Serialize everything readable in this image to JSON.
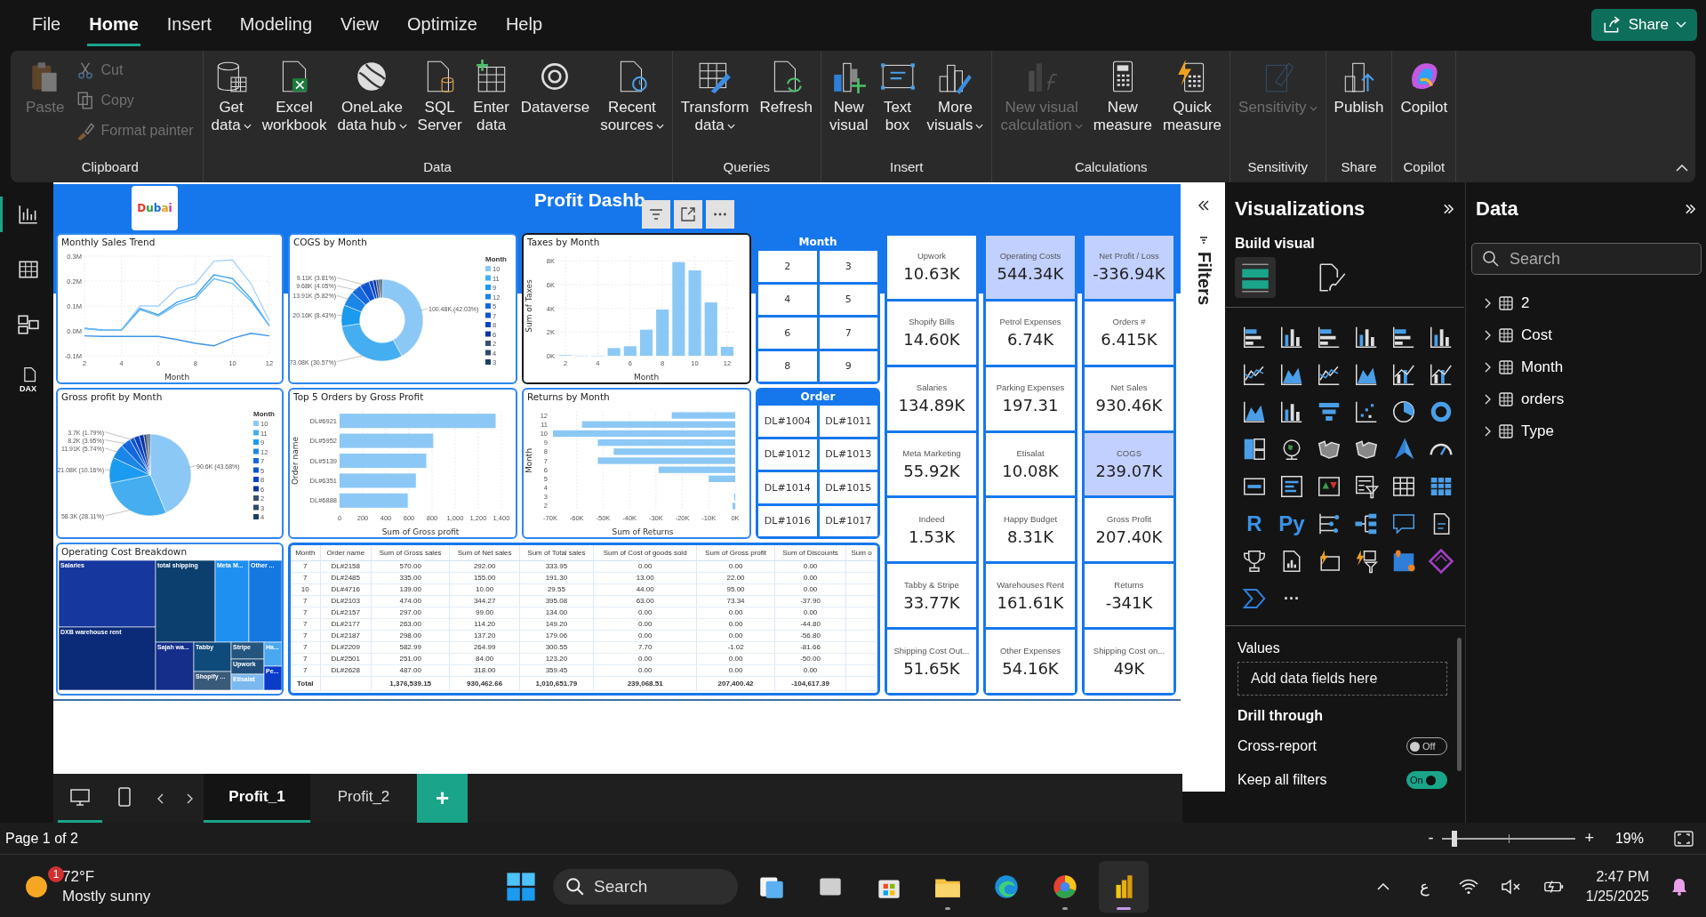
{
  "menu": [
    {
      "label": "File",
      "selected": false
    },
    {
      "label": "Home",
      "selected": true
    },
    {
      "label": "Insert",
      "selected": false
    },
    {
      "label": "Modeling",
      "selected": false
    },
    {
      "label": "View",
      "selected": false
    },
    {
      "label": "Optimize",
      "selected": false
    },
    {
      "label": "Help",
      "selected": false
    }
  ],
  "share": {
    "label": "Share"
  },
  "ribbon": {
    "groups": [
      {
        "label": "Clipboard",
        "buttons": [
          {
            "label": "Paste",
            "kind": "large",
            "disabled": true
          },
          {
            "label": "Cut",
            "kind": "small",
            "disabled": true
          },
          {
            "label": "Copy",
            "kind": "small",
            "disabled": true
          },
          {
            "label": "Format painter",
            "kind": "small",
            "disabled": true
          }
        ]
      },
      {
        "label": "Data",
        "buttons": [
          {
            "label": "Get\ndata",
            "kind": "large",
            "disabled": false,
            "dropdown": true
          },
          {
            "label": "Excel\nworkbook",
            "kind": "large",
            "disabled": false
          },
          {
            "label": "OneLake\ndata hub",
            "kind": "large",
            "disabled": false,
            "dropdown": true
          },
          {
            "label": "SQL\nServer",
            "kind": "large",
            "disabled": false
          },
          {
            "label": "Enter\ndata",
            "kind": "large",
            "disabled": false
          },
          {
            "label": "Dataverse",
            "kind": "large",
            "disabled": false
          },
          {
            "label": "Recent\nsources",
            "kind": "large",
            "disabled": false,
            "dropdown": true
          }
        ]
      },
      {
        "label": "Queries",
        "buttons": [
          {
            "label": "Transform\ndata",
            "kind": "large",
            "disabled": false,
            "dropdown": true
          },
          {
            "label": "Refresh",
            "kind": "large",
            "disabled": false
          }
        ]
      },
      {
        "label": "Insert",
        "buttons": [
          {
            "label": "New\nvisual",
            "kind": "large",
            "disabled": false
          },
          {
            "label": "Text\nbox",
            "kind": "large",
            "disabled": false
          },
          {
            "label": "More\nvisuals",
            "kind": "large",
            "disabled": false,
            "dropdown": true
          }
        ]
      },
      {
        "label": "Calculations",
        "buttons": [
          {
            "label": "New visual\ncalculation",
            "kind": "large",
            "disabled": true,
            "dropdown": true
          },
          {
            "label": "New\nmeasure",
            "kind": "large",
            "disabled": false
          },
          {
            "label": "Quick\nmeasure",
            "kind": "large",
            "disabled": false
          }
        ]
      },
      {
        "label": "Sensitivity",
        "buttons": [
          {
            "label": "Sensitivity",
            "kind": "large",
            "disabled": true,
            "dropdown": true
          }
        ]
      },
      {
        "label": "Share",
        "buttons": [
          {
            "label": "Publish",
            "kind": "large",
            "disabled": false
          }
        ]
      },
      {
        "label": "Copilot",
        "buttons": [
          {
            "label": "Copilot",
            "kind": "large",
            "disabled": false
          }
        ]
      }
    ]
  },
  "left_nav": [
    {
      "selected": true
    },
    {
      "selected": false
    },
    {
      "selected": false
    },
    {
      "selected": false,
      "label": "DAX"
    }
  ],
  "dashboard": {
    "logo": "Dubai",
    "title": "Profit Dashb",
    "charts": [
      {
        "title": "Monthly Sales Trend",
        "selected": false,
        "chart_data": {
          "type": "line",
          "grid": true,
          "xlabel": "Month",
          "x": [
            2,
            3,
            4,
            5,
            6,
            7,
            8,
            9,
            10,
            11,
            12
          ],
          "xlim": [
            2,
            12
          ],
          "ylim": [
            -0.1,
            0.3
          ],
          "xticks": [
            2,
            4,
            6,
            8,
            10,
            12
          ],
          "yticks": [
            {
              "value": -0.1,
              "label": "-0.1M"
            },
            {
              "value": 0,
              "label": "0.0M"
            },
            {
              "value": 0.1,
              "label": "0.1M"
            },
            {
              "value": 0.2,
              "label": "0.2M"
            },
            {
              "value": 0.3,
              "label": "0.3M"
            }
          ],
          "series": [
            {
              "color": "#a9d2f7",
              "values": [
                0.01,
                0.005,
                0.005,
                0.1,
                0.1,
                0.17,
                0.19,
                0.28,
                0.285,
                0.19,
                0.04
              ]
            },
            {
              "color": "#3da3f0",
              "values": [
                0.01,
                0.003,
                0.002,
                0.09,
                0.065,
                0.115,
                0.14,
                0.225,
                0.21,
                0.13,
                0.02
              ]
            },
            {
              "color": "#6cbaf2",
              "values": [
                0.01,
                0.003,
                0.002,
                0.085,
                0.06,
                0.105,
                0.13,
                0.21,
                0.19,
                0.12,
                0.02
              ]
            },
            {
              "color": "#3a94ea",
              "values": [
                -0.02,
                -0.022,
                -0.022,
                -0.022,
                -0.022,
                -0.035,
                -0.05,
                -0.06,
                -0.03,
                -0.01,
                -0.02
              ]
            }
          ]
        }
      },
      {
        "title": "COGS by Month",
        "selected": false,
        "chart_data": {
          "type": "donut",
          "legend": {
            "title": "Month"
          },
          "categories": [
            "10",
            "11",
            "9",
            "12",
            "5",
            "7",
            "8",
            "6",
            "2",
            "4",
            "3"
          ],
          "values": [
            100480,
            73080,
            20160,
            13910,
            9680,
            9110,
            3800,
            3000,
            2300,
            1900,
            1650
          ],
          "colors": [
            "#8cc8f5",
            "#45aef0",
            "#1a9bef",
            "#1a86e6",
            "#1468dc",
            "#0d55d0",
            "#0a44c0",
            "#0a36a0",
            "#3a4e6e",
            "#2c4a6a",
            "#1e3e66"
          ],
          "value_labels": [
            "100.48K (42.03%)",
            "73.08K (30.57%)",
            "20.16K (8.43%)",
            "13.91K (5.82%)",
            "9.68K (4.05%)",
            "9.11K (3.81%)",
            null,
            null,
            null,
            null,
            null
          ]
        }
      },
      {
        "title": "Taxes by Month",
        "selected": true,
        "chart_data": {
          "type": "bar",
          "grid": true,
          "xlabel": "Month",
          "ylabel": "Sum of Taxes",
          "x": [
            2,
            3,
            4,
            5,
            6,
            7,
            8,
            9,
            10,
            11,
            12
          ],
          "xlim": [
            1.5,
            12.5
          ],
          "ylim": [
            0,
            8.4
          ],
          "xticks": [
            2,
            4,
            6,
            8,
            10,
            12
          ],
          "yticks": [
            {
              "value": 0,
              "label": "0K"
            },
            {
              "value": 2,
              "label": "2K"
            },
            {
              "value": 4,
              "label": "4K"
            },
            {
              "value": 6,
              "label": "6K"
            },
            {
              "value": 8,
              "label": "8K"
            }
          ],
          "series": [
            {
              "color": "#8cc8f5",
              "values": [
                0.05,
                0,
                0,
                0.65,
                0.8,
                2.2,
                3.9,
                7.9,
                7.2,
                4.5,
                0.75
              ]
            }
          ]
        }
      },
      {
        "title": "Gross profit by Month",
        "selected": false,
        "chart_data": {
          "type": "pie",
          "legend": {
            "title": "Month"
          },
          "categories": [
            "10",
            "11",
            "9",
            "12",
            "7",
            "5",
            "8",
            "6",
            "2",
            "3",
            "4"
          ],
          "values": [
            90600,
            58300,
            21080,
            11910,
            8200,
            3700,
            4500,
            3800,
            2500,
            1600,
            1200
          ],
          "colors": [
            "#8cc8f5",
            "#45aef0",
            "#1a9bef",
            "#1a86e6",
            "#1468dc",
            "#0d55d0",
            "#0a44c0",
            "#0a36a0",
            "#3a4e6e",
            "#2c4a6a",
            "#1e3e66"
          ],
          "value_labels": [
            "90.6K (43.68%)",
            "58.3K (28.11%)",
            "21.08K (10.16%)",
            "11.91K (5.74%)",
            "8.2K (3.95%)",
            "3.7K (1.79%)",
            null,
            null,
            null,
            null,
            null
          ]
        }
      },
      {
        "title": "Top 5 Orders by Gross Profit",
        "selected": false,
        "chart_data": {
          "type": "bar",
          "orientation": "horizontal",
          "grid": true,
          "xlabel": "Sum of Gross profit",
          "ylabel": "Order name",
          "categories": [
            "DL#6921",
            "DL#5952",
            "DL#5139",
            "DL#6351",
            "DL#6888"
          ],
          "xlim": [
            0,
            1400
          ],
          "xticks": [
            0,
            200,
            400,
            600,
            800,
            {
              "value": 1000,
              "label": "1,000"
            },
            {
              "value": 1200,
              "label": "1,200"
            },
            {
              "value": 1400,
              "label": "1,400"
            }
          ],
          "series": [
            {
              "color": "#8cc8f5",
              "values": [
                1350,
                810,
                750,
                660,
                590
              ]
            }
          ]
        }
      },
      {
        "title": "Returns by Month",
        "selected": false,
        "chart_data": {
          "type": "bar",
          "orientation": "horizontal",
          "grid": true,
          "xlabel": "Sum of Returns",
          "ylabel": "Month",
          "categories": [
            "12",
            "11",
            "10",
            "9",
            "8",
            "7",
            "6",
            "5",
            "4",
            "3",
            "2"
          ],
          "xlim": [
            -70,
            0
          ],
          "xticks": [
            {
              "value": -70,
              "label": "-70K"
            },
            {
              "value": -60,
              "label": "-60K"
            },
            {
              "value": -50,
              "label": "-50K"
            },
            {
              "value": -40,
              "label": "-40K"
            },
            {
              "value": -30,
              "label": "-30K"
            },
            {
              "value": -20,
              "label": "-20K"
            },
            {
              "value": -10,
              "label": "-10K"
            },
            {
              "value": 0,
              "label": "0K"
            }
          ],
          "series": [
            {
              "color": "#8cc8f5",
              "values": [
                -24,
                -58,
                -69,
                -52,
                -46,
                -52,
                -29,
                -10,
                null,
                -0.4,
                -1
              ]
            }
          ]
        }
      }
    ],
    "slicers": [
      {
        "title": "Month",
        "options": [
          {
            "label": "2",
            "selected": false
          },
          {
            "label": "3",
            "selected": false
          },
          {
            "label": "4",
            "selected": false
          },
          {
            "label": "5",
            "selected": false
          },
          {
            "label": "6",
            "selected": false
          },
          {
            "label": "7",
            "selected": false
          },
          {
            "label": "8",
            "selected": false
          },
          {
            "label": "9",
            "selected": false
          }
        ]
      },
      {
        "title": "Order",
        "options": [
          {
            "label": "DL#1004",
            "selected": false
          },
          {
            "label": "DL#1011",
            "selected": false
          },
          {
            "label": "DL#1012",
            "selected": false
          },
          {
            "label": "DL#1013",
            "selected": false
          },
          {
            "label": "DL#1014",
            "selected": false
          },
          {
            "label": "DL#1015",
            "selected": false
          },
          {
            "label": "DL#1016",
            "selected": false
          },
          {
            "label": "DL#1017",
            "selected": false
          }
        ]
      }
    ],
    "treemap": {
      "title": "Operating Cost Breakdown",
      "tiles": [
        {
          "label": "Salaries",
          "color": "#16379e"
        },
        {
          "label": "DXB warehouse rent",
          "color": "#0b2a78"
        },
        {
          "label": "total shipping",
          "color": "#0c3f6e"
        },
        {
          "label": "Meta M...",
          "color": "#1e90f0"
        },
        {
          "label": "Other ...",
          "color": "#1478e0"
        },
        {
          "label": "Sajah wa...",
          "color": "#142e8a"
        },
        {
          "label": "Tabby",
          "color": "#0e4a7a"
        },
        {
          "label": "Shopify ...",
          "color": "#3a5a7a"
        },
        {
          "label": "Stripe",
          "color": "#23557f"
        },
        {
          "label": "Upwork",
          "color": "#1f4f7a"
        },
        {
          "label": "Etisalat",
          "color": "#7ab8f0"
        },
        {
          "label": "Ha...",
          "color": "#4aa8f0"
        },
        {
          "label": "Pe...",
          "color": "#0a3cc8"
        }
      ]
    },
    "table": {
      "columns": [
        "Month",
        "Order name",
        "Sum of Gross sales",
        "Sum of Net sales",
        "Sum of Total sales",
        "Sum of Cost of goods sold",
        "Sum of Gross profit",
        "Sum of Discounts",
        "Sum o"
      ],
      "rows": [
        [
          "7",
          "DL#2158",
          "570.00",
          "292.00",
          "333.95",
          "0.00",
          "0.00",
          "0.00"
        ],
        [
          "7",
          "DL#2485",
          "335.00",
          "155.00",
          "191.30",
          "13.00",
          "22.00",
          "0.00"
        ],
        [
          "10",
          "DL#4716",
          "139.00",
          "10.00",
          "29.55",
          "44.00",
          "95.00",
          "0.00"
        ],
        [
          "7",
          "DL#2103",
          "474.00",
          "344.27",
          "395.08",
          "63.00",
          "73.34",
          "-37.90"
        ],
        [
          "7",
          "DL#2157",
          "297.00",
          "99.00",
          "134.00",
          "0.00",
          "0.00",
          "0.00"
        ],
        [
          "7",
          "DL#2177",
          "263.00",
          "114.20",
          "149.20",
          "0.00",
          "0.00",
          "-44.80"
        ],
        [
          "7",
          "DL#2187",
          "298.00",
          "137.20",
          "179.06",
          "0.00",
          "0.00",
          "-56.80"
        ],
        [
          "7",
          "DL#2209",
          "582.99",
          "264.99",
          "300.55",
          "7.70",
          "-1.02",
          "-81.66"
        ],
        [
          "7",
          "DL#2501",
          "251.00",
          "84.00",
          "123.20",
          "0.00",
          "0.00",
          "-50.00"
        ],
        [
          "7",
          "DL#2628",
          "487.00",
          "318.00",
          "359.45",
          "0.00",
          "0.00",
          "0.00"
        ]
      ],
      "total": {
        "label": "Total",
        "values": [
          "1,376,539.15",
          "930,462.66",
          "1,010,651.79",
          "239,068.51",
          "207,400.42",
          "-104,617.39"
        ]
      }
    },
    "card_columns": [
      [
        {
          "title": "Upwork",
          "value": "10.63K",
          "highlighted": false
        },
        {
          "title": "Shopify Bills",
          "value": "14.60K",
          "highlighted": false
        },
        {
          "title": "Salaries",
          "value": "134.89K",
          "highlighted": false
        },
        {
          "title": "Meta Marketing",
          "value": "55.92K",
          "highlighted": false
        },
        {
          "title": "Indeed",
          "value": "1.53K",
          "highlighted": false
        },
        {
          "title": "Tabby & Stripe",
          "value": "33.77K",
          "highlighted": false
        },
        {
          "title": "Shipping Cost Out...",
          "value": "51.65K",
          "highlighted": false
        }
      ],
      [
        {
          "title": "Operating Costs",
          "value": "544.34K",
          "highlighted": true
        },
        {
          "title": "Petrol Expenses",
          "value": "6.74K",
          "highlighted": false
        },
        {
          "title": "Parking Expenses",
          "value": "197.31",
          "highlighted": false
        },
        {
          "title": "Etisalat",
          "value": "10.08K",
          "highlighted": false
        },
        {
          "title": "Happy Budget",
          "value": "8.31K",
          "highlighted": false
        },
        {
          "title": "Warehouses Rent",
          "value": "161.61K",
          "highlighted": false
        },
        {
          "title": "Other Expenses",
          "value": "54.16K",
          "highlighted": false
        }
      ],
      [
        {
          "title": "Net Profit / Loss",
          "value": "-336.94K",
          "highlighted": true
        },
        {
          "title": "Orders #",
          "value": "6.415K",
          "highlighted": false
        },
        {
          "title": "Net Sales",
          "value": "930.46K",
          "highlighted": false
        },
        {
          "title": "COGS",
          "value": "239.07K",
          "highlighted": true
        },
        {
          "title": "Gross Profit",
          "value": "207.40K",
          "highlighted": false
        },
        {
          "title": "Returns",
          "value": "-341K",
          "highlighted": false
        },
        {
          "title": "Shipping Cost on...",
          "value": "49K",
          "highlighted": false
        }
      ]
    ]
  },
  "layout_views": [
    {
      "selected": true
    },
    {
      "selected": false
    }
  ],
  "pages": [
    {
      "label": "Profit_1",
      "selected": true
    },
    {
      "label": "Profit_2",
      "selected": false
    }
  ],
  "add_page": "+",
  "filters_pane": {
    "title": "Filters"
  },
  "visualizations": {
    "title": "Visualizations",
    "subtitle": "Build visual",
    "tabs": [
      {
        "selected": true
      },
      {
        "selected": false
      }
    ],
    "gallery_glyphs": [
      "R",
      "Py",
      "···"
    ],
    "values_label": "Values",
    "values_placeholder": "Add data fields here",
    "drill_title": "Drill through",
    "toggles": [
      {
        "label": "Cross-report",
        "on": false,
        "state_text": "Off"
      },
      {
        "label": "Keep all filters",
        "on": true,
        "state_text": "On"
      }
    ]
  },
  "data_pane": {
    "title": "Data",
    "search": {
      "placeholder": "Search"
    },
    "tables": [
      {
        "label": "2",
        "expanded": false
      },
      {
        "label": "Cost",
        "expanded": false
      },
      {
        "label": "Month",
        "expanded": false
      },
      {
        "label": "orders",
        "expanded": false
      },
      {
        "label": "Type",
        "expanded": false
      }
    ]
  },
  "status_bar": {
    "page": "Page 1 of 2",
    "zoom_minus": "-",
    "zoom_plus": "+",
    "zoom": {
      "level": 0.07
    },
    "zoom_text": "19%"
  },
  "taskbar": {
    "weather": {
      "temp": "72°F",
      "condition": "Mostly sunny",
      "badge": "1"
    },
    "search": {
      "placeholder": "Search"
    },
    "apps": [
      {
        "running": false,
        "active": false
      },
      {
        "running": false,
        "active": false
      },
      {
        "running": false,
        "active": false
      },
      {
        "running": true,
        "active": false
      },
      {
        "running": false,
        "active": false
      },
      {
        "running": true,
        "active": false
      },
      {
        "running": true,
        "active": true
      }
    ],
    "keyboard": "ع",
    "time": "2:47 PM",
    "date": "1/25/2025"
  }
}
